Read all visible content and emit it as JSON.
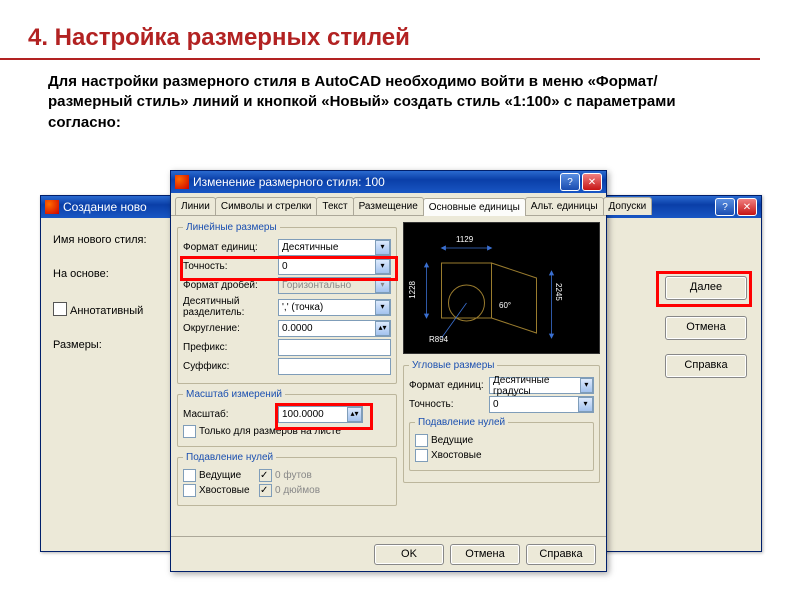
{
  "slide": {
    "title": "4. Настройка размерных стилей",
    "body": "Для настройки размерного стиля в AutoCAD необходимо войти в меню «Формат/размерный стиль» линий и кнопкой «Новый» создать стиль «1:100» с параметрами согласно:"
  },
  "back_window": {
    "title": "Создание ново",
    "lbl_new_style": "Имя нового стиля:",
    "lbl_based_on": "На основе:",
    "lbl_annotative": "Аннотативный",
    "lbl_sizes": "Размеры:",
    "btn_next": "Далее",
    "btn_cancel": "Отмена",
    "btn_help": "Справка"
  },
  "front_window": {
    "title": "Изменение размерного стиля: 100",
    "tabs": [
      "Линии",
      "Символы и стрелки",
      "Текст",
      "Размещение",
      "Основные единицы",
      "Альт. единицы",
      "Допуски"
    ],
    "grp_linear": "Линейные размеры",
    "lbl_unit_format": "Формат единиц:",
    "val_unit_format": "Десятичные",
    "lbl_precision": "Точность:",
    "val_precision": "0",
    "lbl_fraction": "Формат дробей:",
    "val_fraction": "Горизонтально",
    "lbl_sep": "Десятичный разделитель:",
    "val_sep": "',' (точка)",
    "lbl_round": "Округление:",
    "val_round": "0.0000",
    "lbl_prefix": "Префикс:",
    "lbl_suffix": "Суффикс:",
    "grp_scale": "Масштаб измерений",
    "lbl_scale": "Масштаб:",
    "val_scale": "100.0000",
    "lbl_layout_only": "Только для размеров на листе",
    "grp_suppress": "Подавление нулей",
    "lbl_leading": "Ведущие",
    "lbl_trailing": "Хвостовые",
    "lbl_feet": "0 футов",
    "lbl_inches": "0 дюймов",
    "grp_angular": "Угловые размеры",
    "lbl_ang_format": "Формат единиц:",
    "val_ang_format": "Десятичные градусы",
    "lbl_ang_prec": "Точность:",
    "val_ang_prec": "0",
    "grp_ang_suppress": "Подавление нулей",
    "lbl_ang_leading": "Ведущие",
    "lbl_ang_trailing": "Хвостовые",
    "btn_ok": "OK",
    "btn_cancel": "Отмена",
    "btn_help": "Справка",
    "preview_dims": {
      "top": "1129",
      "left": "1228",
      "right": "2245",
      "ang": "60°",
      "rad": "R894"
    }
  }
}
